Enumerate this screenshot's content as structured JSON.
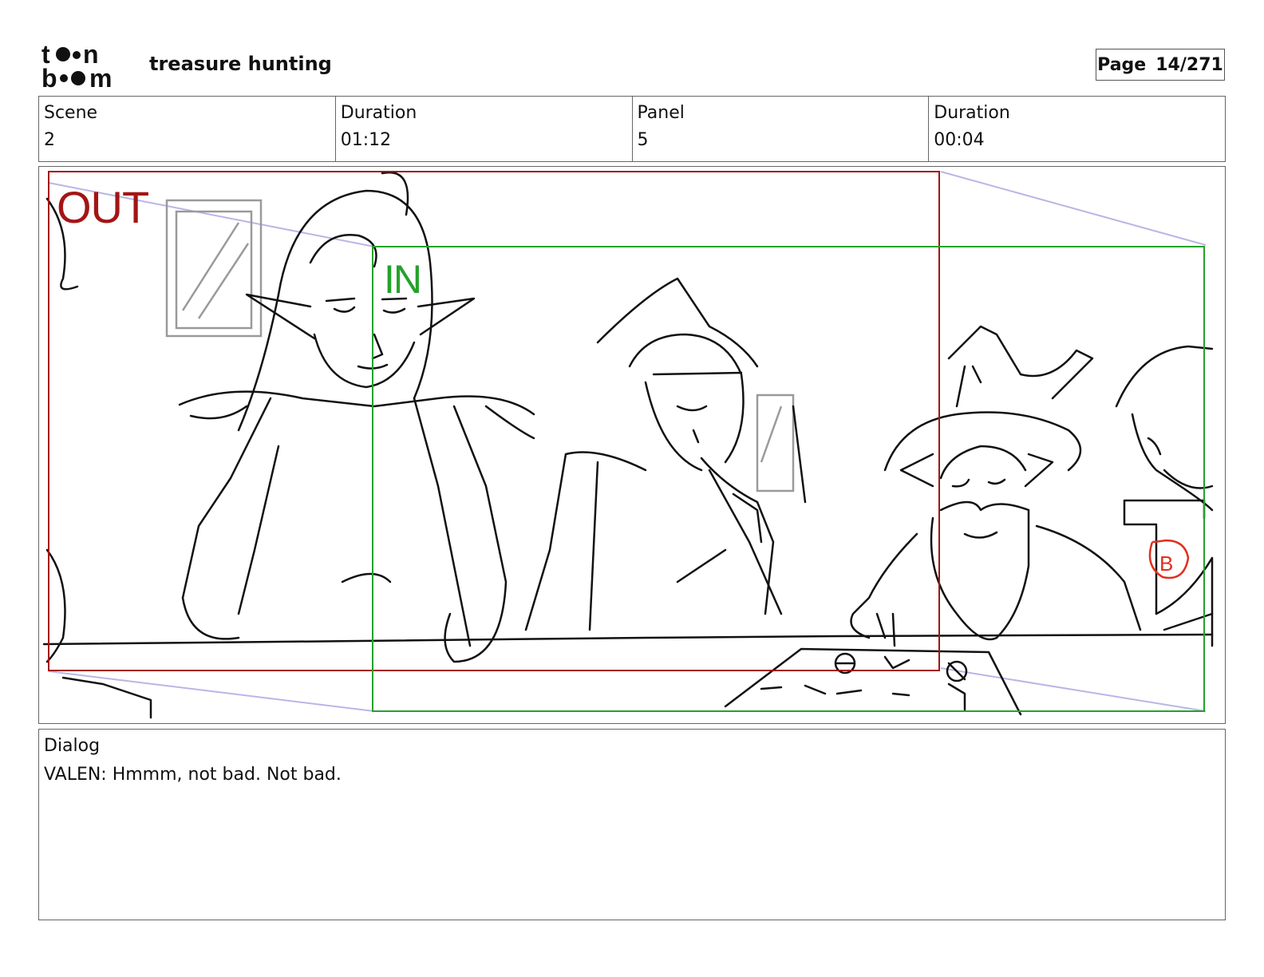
{
  "header": {
    "logo_text": "toon boom",
    "project_title": "treasure hunting",
    "page_label": "Page",
    "page_number": "14/271"
  },
  "info": {
    "scene_label": "Scene",
    "scene_value": "2",
    "scene_duration_label": "Duration",
    "scene_duration_value": "01:12",
    "panel_label": "Panel",
    "panel_value": "5",
    "panel_duration_label": "Duration",
    "panel_duration_value": "00:04"
  },
  "panel": {
    "out_label": "OUT",
    "in_label": "IN",
    "marker_label": "B",
    "colors": {
      "out_frame": "#a31515",
      "in_frame": "#26a12a",
      "marker": "#e0301e",
      "guide": "#b9b6e6"
    }
  },
  "dialog": {
    "label": "Dialog",
    "text": "VALEN: Hmmm, not bad. Not bad."
  }
}
